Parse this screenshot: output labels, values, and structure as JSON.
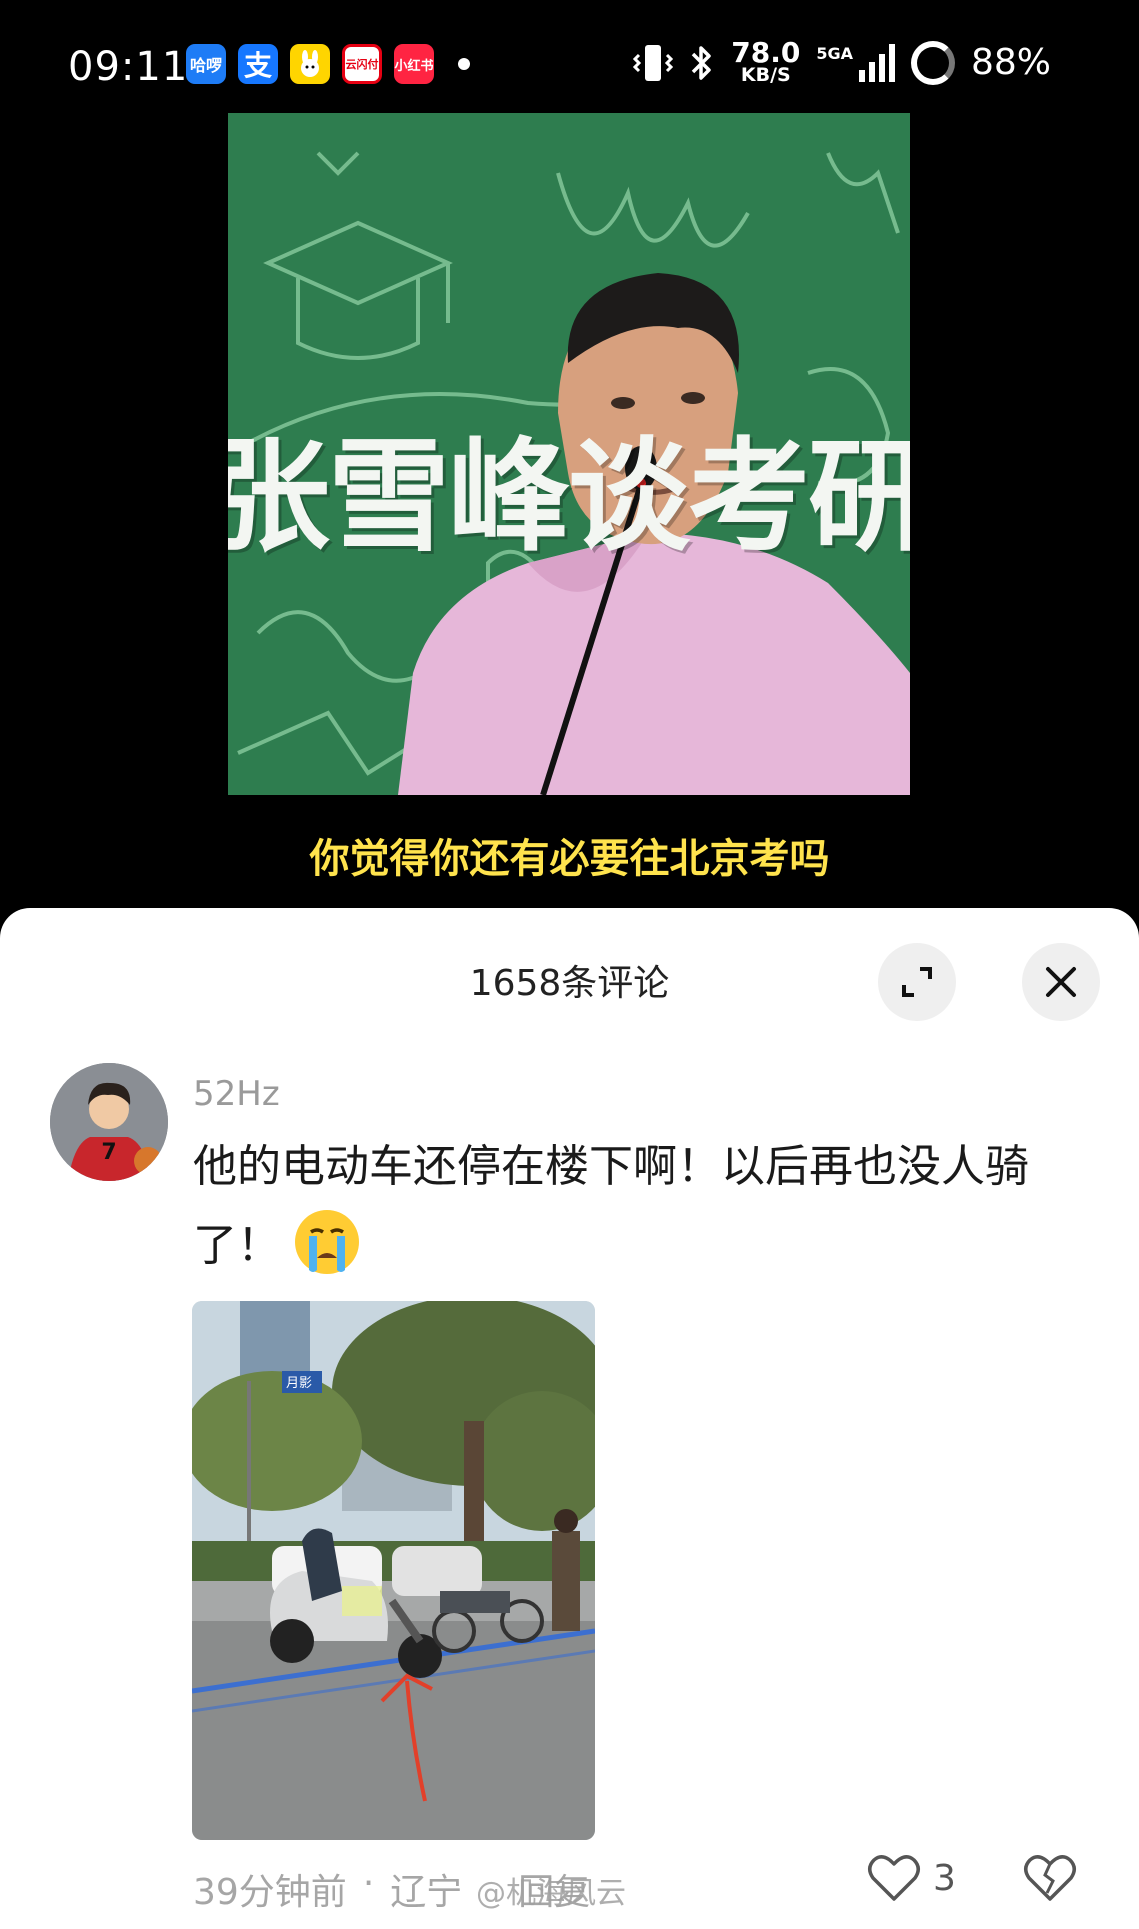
{
  "status_bar": {
    "time": "09:11",
    "app_icons": [
      {
        "name": "hello-app",
        "label": "哈啰",
        "color": "#1e7cf6"
      },
      {
        "name": "alipay-app",
        "label": "支",
        "color": "#1677ff"
      },
      {
        "name": "rabbit-app",
        "label": "",
        "color": "#ffd500"
      },
      {
        "name": "unionpay-app",
        "label": "云闪付",
        "color": "#e60012"
      },
      {
        "name": "xiaohongshu-app",
        "label": "小红书",
        "color": "#ff2442"
      }
    ],
    "net_speed_value": "78.0",
    "net_speed_unit": "KB/S",
    "signal_label": "5GA",
    "battery_percent": "88%"
  },
  "video": {
    "overlay_title": "张雪峰谈考研",
    "subtitle": "你觉得你还有必要往北京考吗"
  },
  "comments": {
    "header_title": "1658条评论",
    "items": [
      {
        "username": "52Hz",
        "avatar_jersey": "SHOHOKU 7",
        "text": "他的电动车还停在楼下啊！以后再也没人骑了！",
        "emoji": "crying-face",
        "photo_sign": "月影",
        "time_ago": "39分钟前",
        "separator": "·",
        "location": "辽宁",
        "reply_label": "回复",
        "likes": "3"
      }
    ],
    "watermark": "@机海风云"
  }
}
